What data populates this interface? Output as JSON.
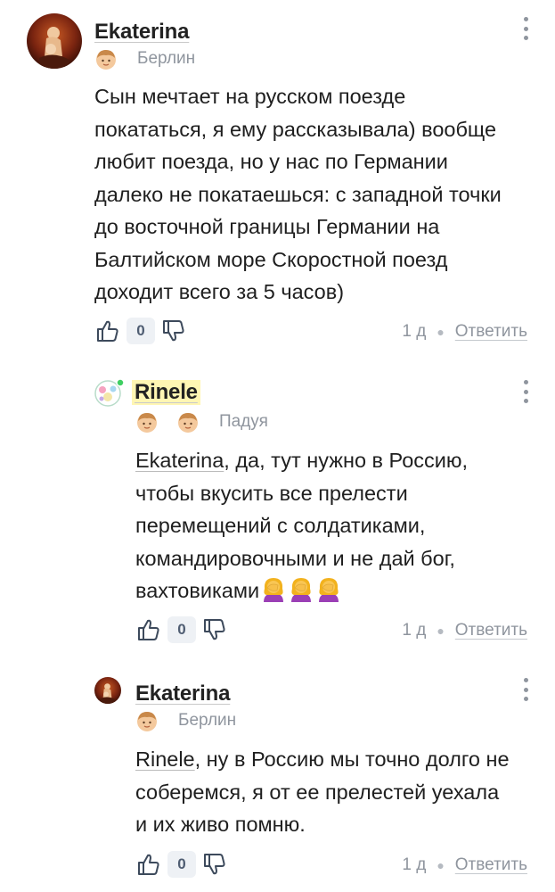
{
  "comments": [
    {
      "author": "Ekaterina",
      "city": "Берлин",
      "text": "Сын мечтает на русском поезде покататься, я ему рассказывала) вообще любит поезда, но у нас по Германии далеко не покатаешься: с западной точки до восточной границы Германии на Балтийском море Скоростной поезд доходит всего за 5 часов)",
      "lines": [
        "Сын мечтает на русском поезде",
        "покататься, я ему рассказывала) вообще",
        "любит поезда, но у нас по Германии",
        "далеко не покатаешься: с западной точки",
        "до восточной границы Германии на",
        "Балтийском море Скоростной поезд",
        "доходит всего за 5 часов)"
      ],
      "score": "0",
      "age": "1 д",
      "reply_label": "Ответить",
      "badges": [
        "boy-badge-icon"
      ]
    },
    {
      "author": "Rinele",
      "city": "Падуя",
      "mention": "Ekaterina",
      "lines_rest": [
        ", да, тут нужно в Россию,",
        "чтобы вкусить все прелести",
        "перемещений с солдатиками,",
        "командировочными и не дай бог,",
        "вахтовиками"
      ],
      "emoji": [
        "facepalm-woman-icon",
        "facepalm-woman-icon",
        "facepalm-woman-icon"
      ],
      "score": "0",
      "age": "1 д",
      "reply_label": "Ответить",
      "badges": [
        "boy-badge-icon",
        "boy-badge-icon"
      ],
      "online": true
    },
    {
      "author": "Ekaterina",
      "city": "Берлин",
      "mention": "Rinele",
      "lines_rest": [
        ", ну в Россию мы точно долго не",
        "соберемся, я от ее прелестей уехала",
        "и их живо помню."
      ],
      "score": "0",
      "age": "1 д",
      "reply_label": "Ответить",
      "badges": [
        "boy-badge-icon"
      ]
    }
  ],
  "colors": {
    "meta": "#8f959e",
    "highlight": "#fff6b3",
    "score_bg": "#eef1f5",
    "online": "#3fcf62"
  }
}
